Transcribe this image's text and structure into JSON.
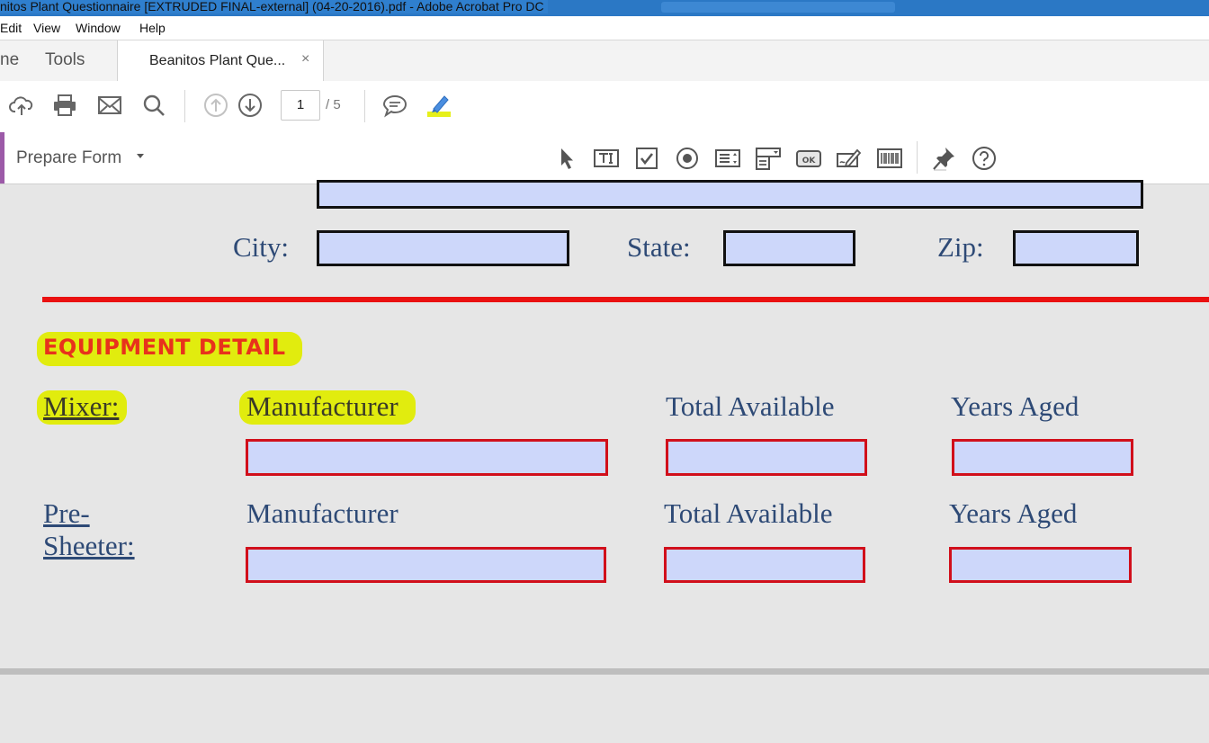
{
  "window": {
    "title": "nitos Plant Questionnaire [EXTRUDED FINAL-external] (04-20-2016).pdf - Adobe Acrobat Pro DC"
  },
  "menubar": {
    "items": [
      "Edit",
      "View",
      "Window",
      "Help"
    ]
  },
  "tabs": {
    "home": "ne",
    "tools": "Tools",
    "document_tab": "Beanitos Plant Que...",
    "close_symbol": "×"
  },
  "toolbar": {
    "page_current": "1",
    "page_total": "/ 5",
    "icons": [
      "upload-icon",
      "print-icon",
      "email-icon",
      "search-icon",
      "page-up-icon",
      "page-down-icon",
      "comment-icon",
      "highlighter-icon"
    ]
  },
  "prepare_form": {
    "title": "Prepare Form",
    "icons": [
      "select-cursor-icon",
      "text-field-icon",
      "checkbox-icon",
      "radio-button-icon",
      "list-box-icon",
      "dropdown-icon",
      "button-ok-icon",
      "signature-icon",
      "barcode-icon",
      "pin-icon",
      "help-icon"
    ],
    "ok_text": "OK"
  },
  "document": {
    "city_label": "City:",
    "state_label": "State:",
    "zip_label": "Zip:",
    "section_title": "EQUIPMENT DETAIL",
    "mixer": {
      "label": "Mixer:",
      "manufacturer": "Manufacturer",
      "total_available": "Total Available",
      "years_aged": "Years Aged"
    },
    "presheeter": {
      "label_line1": "Pre-",
      "label_line2": "Sheeter:",
      "manufacturer": "Manufacturer",
      "total_available": "Total Available",
      "years_aged": "Years Aged"
    }
  },
  "colors": {
    "field_fill": "#cdd7fa",
    "required_border": "#d10f1b",
    "highlight": "#e1ec0e",
    "divider": "#ea1111",
    "section_title": "#e8321c",
    "label_text": "#2e4a76",
    "prepare_accent": "#9c5aa8"
  }
}
